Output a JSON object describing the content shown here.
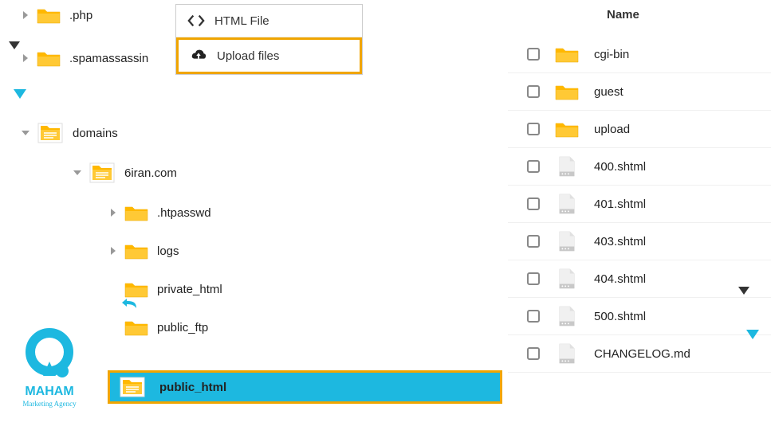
{
  "context_menu": {
    "item1": "HTML File",
    "item2": "Upload files"
  },
  "tree": {
    "php": ".php",
    "spamass": ".spamassassin",
    "domains": "domains",
    "sixiran": "6iran.com",
    "htpasswd": ".htpasswd",
    "logs": "logs",
    "private_html": "private_html",
    "public_ftp": "public_ftp",
    "public_html": "public_html"
  },
  "file_panel": {
    "header_name": "Name",
    "items": [
      {
        "name": "cgi-bin",
        "type": "folder"
      },
      {
        "name": "guest",
        "type": "folder"
      },
      {
        "name": "upload",
        "type": "folder"
      },
      {
        "name": "400.shtml",
        "type": "file"
      },
      {
        "name": "401.shtml",
        "type": "file"
      },
      {
        "name": "403.shtml",
        "type": "file"
      },
      {
        "name": "404.shtml",
        "type": "file"
      },
      {
        "name": "500.shtml",
        "type": "file"
      },
      {
        "name": "CHANGELOG.md",
        "type": "file"
      }
    ]
  },
  "logo": {
    "text1": "MAHAM",
    "text2": "Marketing Agency"
  }
}
